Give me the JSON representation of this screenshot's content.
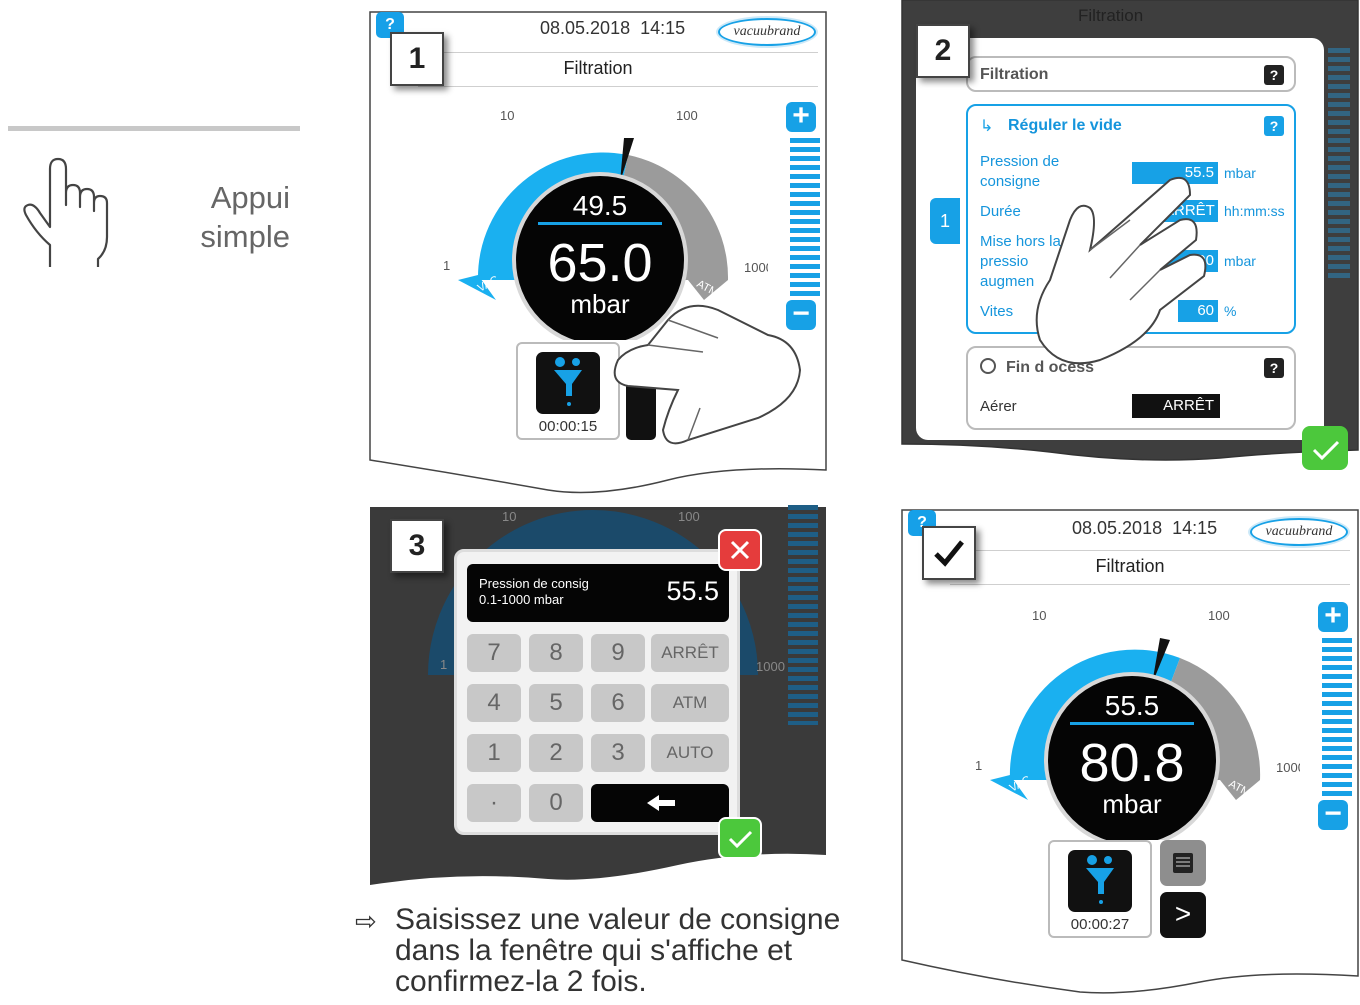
{
  "legend": {
    "gesture_icon": "hand-tap-icon",
    "label": "Appui simple"
  },
  "panel1": {
    "step": "1",
    "help": "?",
    "date": "08.05.2018",
    "time": "14:15",
    "brand": "vacuubrand",
    "title": "Filtration",
    "gauge": {
      "tick_10": "10",
      "tick_100": "100",
      "tick_1": "1",
      "tick_1000": "1000",
      "vac": "VAC",
      "atm": "ATM",
      "setpoint": "49.5",
      "pressure": "65.0",
      "unit": "mbar"
    },
    "plus": "+",
    "minus": "−",
    "program_time": "00:00:15"
  },
  "panel2": {
    "step": "2",
    "bg_title": "Filtration",
    "card_title": "Filtration",
    "q": "?",
    "section_title": "Réguler le vide",
    "rows": [
      {
        "label": "Pression de consigne",
        "value": "55.5",
        "unit": "mbar"
      },
      {
        "label": "Durée",
        "value": "ARRÊT",
        "unit": "hh:mm:ss"
      },
      {
        "label": "Mise hors la pressio augmen",
        "value": "500",
        "unit": "mbar"
      },
      {
        "label": "Vites",
        "value": "60",
        "unit": "%"
      }
    ],
    "side_tab": "1",
    "end_section_title": "Fin d    ocess",
    "vent_label": "Aérer",
    "vent_value": "ARRÊT"
  },
  "panel3": {
    "step": "3",
    "bg_10": "10",
    "bg_100": "100",
    "bg_1": "1",
    "bg_1000": "1000",
    "input_label": "Pression de consig",
    "input_range": "0.1-1000 mbar",
    "input_value": "55.5",
    "keys": [
      "7",
      "8",
      "9",
      "ARRÊT",
      "4",
      "5",
      "6",
      "ATM",
      "1",
      "2",
      "3",
      "AUTO",
      "·",
      "0"
    ]
  },
  "panel4": {
    "help": "?",
    "date": "08.05.2018",
    "time": "14:15",
    "brand": "vacuubrand",
    "title": "Filtration",
    "gauge": {
      "tick_10": "10",
      "tick_100": "100",
      "tick_1": "1",
      "tick_1000": "1000",
      "vac": "VAC",
      "atm": "ATM",
      "setpoint": "55.5",
      "pressure": "80.8",
      "unit": "mbar"
    },
    "plus": "+",
    "minus": "−",
    "program_time": "00:00:27",
    "next": ">"
  },
  "caption": {
    "arrow": "⇨",
    "text": "Saisissez une valeur de consigne dans la fenêtre qui s'affiche et confirmez-la 2 fois."
  },
  "colors": {
    "accent": "#17a1e6",
    "ok_green": "#4cc83c",
    "cancel_red": "#e53c3c",
    "gauge_gray": "#9b9b9b"
  }
}
